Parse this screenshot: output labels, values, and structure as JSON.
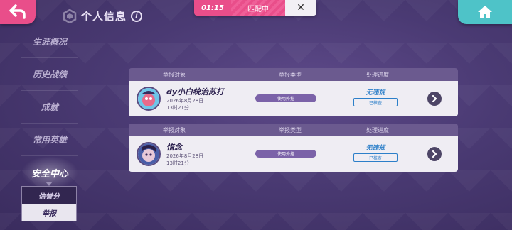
{
  "header": {
    "title": "个人信息",
    "info_label": "i",
    "back_icon": "back-arrow-icon",
    "home_icon": "home-icon"
  },
  "match": {
    "time": "01:15",
    "status": "匹配中",
    "close_label": "✕"
  },
  "sidebar": {
    "items": [
      {
        "label": "生涯概况"
      },
      {
        "label": "历史战绩"
      },
      {
        "label": "成就"
      },
      {
        "label": "常用英雄"
      },
      {
        "label": "安全中心"
      }
    ],
    "active_index": 4,
    "sub_items": [
      {
        "label": "信誉分"
      },
      {
        "label": "举报"
      }
    ]
  },
  "reports": [
    {
      "columns": {
        "target": "举报对象",
        "type": "举报类型",
        "progress": "处理进度"
      },
      "user_name": "dy小白统治苏打",
      "date": "2026年8月28日",
      "time": "13时21分",
      "type": "使用外挂",
      "result": "无违规",
      "status_tag": "已核查"
    },
    {
      "columns": {
        "target": "举报对象",
        "type": "举报类型",
        "progress": "处理进度"
      },
      "user_name": "惜念",
      "date": "2026年8月28日",
      "time": "13时21分",
      "type": "使用外挂",
      "result": "无违规",
      "status_tag": "已核查"
    }
  ],
  "colors": {
    "accent_pink": "#e94e8a",
    "accent_teal": "#4ec3c8",
    "result_blue": "#2c7fc9",
    "badge_purple": "#7b62a8"
  }
}
